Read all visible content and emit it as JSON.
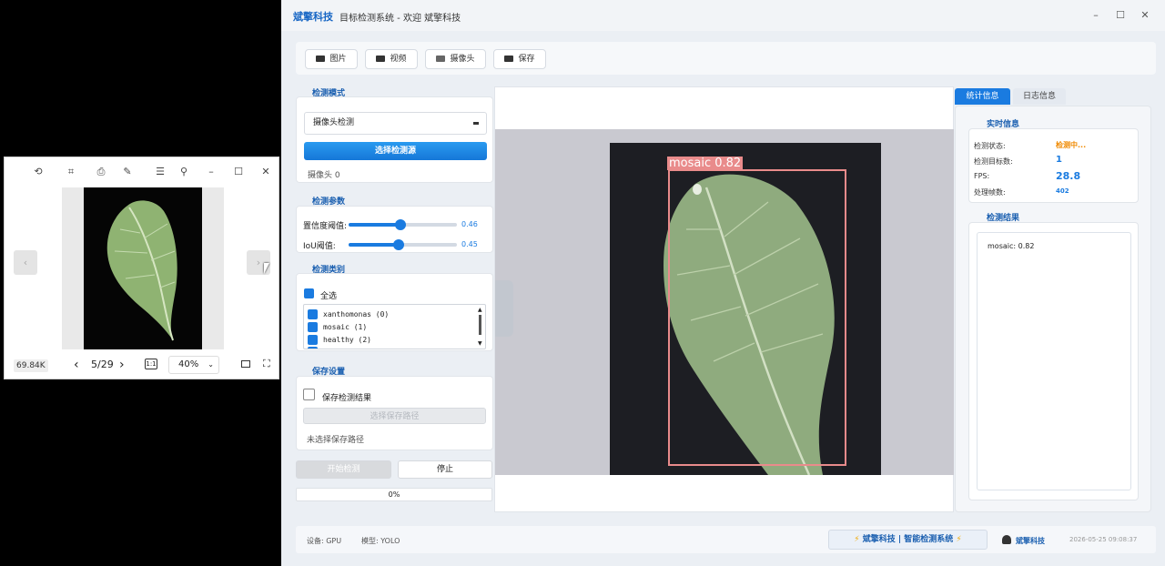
{
  "viewer": {
    "size": "69.84K",
    "page": "5/29",
    "zoom": "40%"
  },
  "main": {
    "brand": "斌擎科技",
    "title": "目标检测系统 - 欢迎 斌擎科技",
    "toolbar": {
      "image": "图片",
      "video": "视频",
      "camera": "摄像头",
      "save": "保存"
    },
    "mode": {
      "heading": "检测模式",
      "selected": "摄像头检测",
      "select_source": "选择检测源",
      "source_status": "摄像头 0"
    },
    "params": {
      "heading": "检测参数",
      "conf_label": "置信度阈值:",
      "conf_value": "0.46",
      "conf_fraction": 0.46,
      "iou_label": "IoU阈值:",
      "iou_value": "0.45",
      "iou_fraction": 0.45
    },
    "classes": {
      "heading": "检测类别",
      "select_all": "全选",
      "items": [
        "xanthomonas (0)",
        "mosaic (1)",
        "healthy (2)"
      ]
    },
    "save_settings": {
      "heading": "保存设置",
      "save_result": "保存检测结果",
      "choose_path": "选择保存路径",
      "path_status": "未选择保存路径"
    },
    "actions": {
      "start": "开始检测",
      "stop": "停止",
      "progress": "0%",
      "progress_fraction": 0
    },
    "detection": {
      "label": "mosaic  0.82"
    },
    "right": {
      "tab_stats": "统计信息",
      "tab_log": "日志信息",
      "realtime_heading": "实时信息",
      "status_label": "检测状态:",
      "status_value": "检测中...",
      "count_label": "检测目标数:",
      "count_value": "1",
      "fps_label": "FPS:",
      "fps_value": "28.8",
      "frames_label": "处理帧数:",
      "frames_value": "402",
      "result_heading": "检测结果",
      "result_text": "mosaic: 0.82"
    },
    "footer": {
      "device": "设备: GPU",
      "model": "模型: YOLO",
      "badge": "斌擎科技 | 智能检测系统",
      "user": "斌擎科技",
      "datetime": "2026-05-25 09:08:37"
    }
  },
  "colors": {
    "accent": "#1a7be0",
    "brand": "#1665c4",
    "box": "#e98b8b",
    "status": "#f08a00"
  }
}
